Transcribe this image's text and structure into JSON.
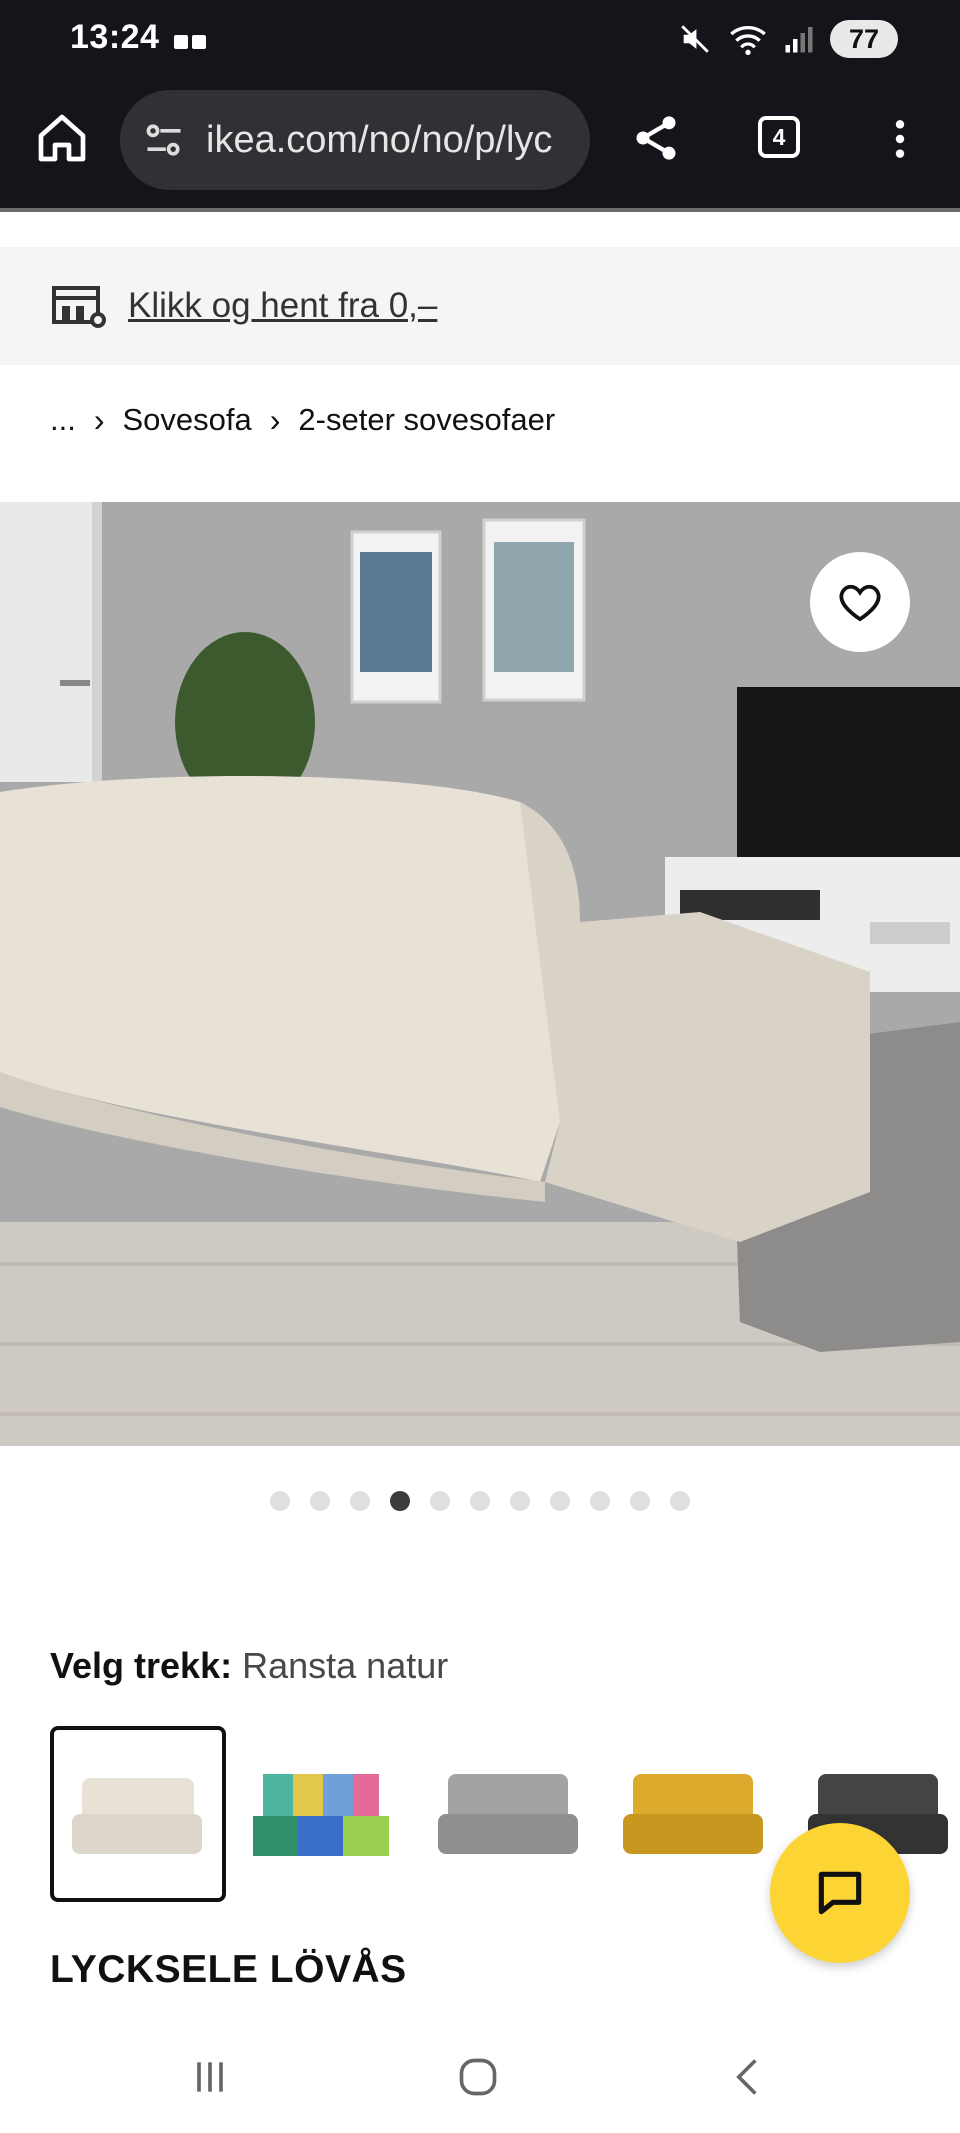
{
  "status_bar": {
    "time": "13:24",
    "battery": "77"
  },
  "browser": {
    "url": "ikea.com/no/no/p/lyc",
    "tab_count": "4"
  },
  "pickup_banner": {
    "text": "Klikk og hent fra 0,–"
  },
  "breadcrumb": {
    "ellipsis": "...",
    "items": [
      "Sovesofa",
      "2-seter sovesofaer"
    ]
  },
  "gallery": {
    "dot_count": 11,
    "active_index": 3
  },
  "cover": {
    "label": "Velg trekk:",
    "value": "Ransta natur",
    "swatches": [
      {
        "name": "Ransta natur",
        "color": "#e8e2d6"
      },
      {
        "name": "multicolor",
        "color": "#4db5a0"
      },
      {
        "name": "grey",
        "color": "#9a9a9a"
      },
      {
        "name": "yellow",
        "color": "#d9a62a"
      },
      {
        "name": "dark grey",
        "color": "#3a3a3a"
      }
    ]
  },
  "product": {
    "name": "LYCKSELE LÖVÅS"
  },
  "colors": {
    "accent_yellow": "#fcd535",
    "toolbar": "#13151a"
  }
}
